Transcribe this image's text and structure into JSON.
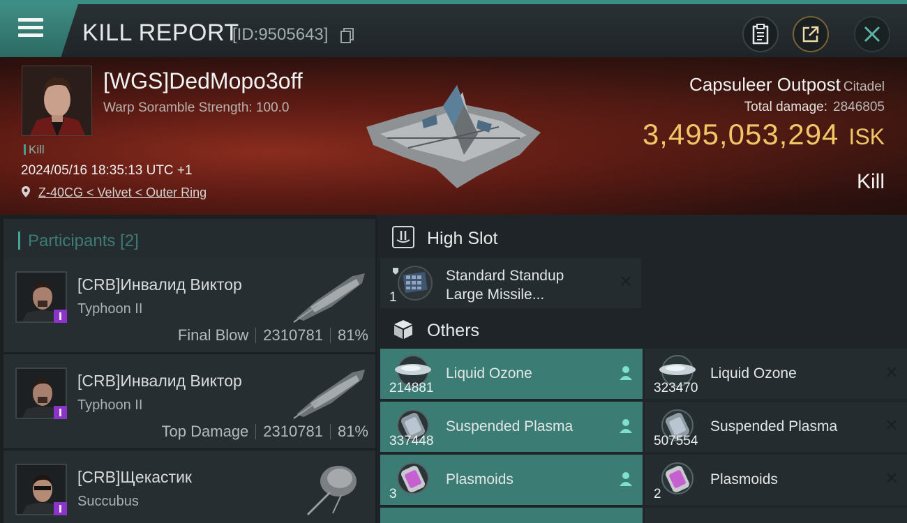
{
  "header": {
    "title": "KILL REPORT",
    "id_text": "[ID:9505643]",
    "accent": "#3c8f86"
  },
  "victim": {
    "name": "[WGS]DedMopo3off",
    "subtitle": "Warp Soramble Strength: 100.0",
    "tag": "Kill",
    "datetime": "2024/05/16 18:35:13 UTC +1",
    "location": "Z-40CG < Velvet < Outer Ring"
  },
  "target": {
    "name": "Capsuleer Outpost",
    "type": "Citadel",
    "damage_label": "Total damage:",
    "damage_value": "2846805",
    "isk_value": "3,495,053,294",
    "isk_unit": "ISK",
    "result": "Kill",
    "isk_color": "#f2c567"
  },
  "participants": {
    "heading": "Participants [2]",
    "rows": [
      {
        "name": "[CRB]Инвалид Виктор",
        "ship": "Typhoon II",
        "role": "Final Blow",
        "damage": "2310781",
        "percent": "81%"
      },
      {
        "name": "[CRB]Инвалид Виктор",
        "ship": "Typhoon II",
        "role": "Top Damage",
        "damage": "2310781",
        "percent": "81%"
      },
      {
        "name": "[CRB]Щекастик",
        "ship": "Succubus"
      }
    ]
  },
  "high_slot": {
    "title": "High Slot",
    "items": [
      {
        "name_line1": "Standard Standup",
        "name_line2": "Large Missile...",
        "qty": "1"
      }
    ]
  },
  "others": {
    "title": "Others",
    "items": [
      {
        "name": "Liquid Ozone",
        "qty": "214881",
        "dropped": true
      },
      {
        "name": "Liquid Ozone",
        "qty": "323470",
        "dropped": false
      },
      {
        "name": "Suspended Plasma",
        "qty": "337448",
        "dropped": true
      },
      {
        "name": "Suspended Plasma",
        "qty": "507554",
        "dropped": false
      },
      {
        "name": "Plasmoids",
        "qty": "3",
        "dropped": true
      },
      {
        "name": "Plasmoids",
        "qty": "2",
        "dropped": false
      }
    ]
  },
  "icons": [
    "menu-icon",
    "copy-icon",
    "clipboard-icon",
    "share-icon",
    "close-icon",
    "location-pin-icon",
    "high-slot-icon",
    "cube-icon",
    "person-icon"
  ]
}
